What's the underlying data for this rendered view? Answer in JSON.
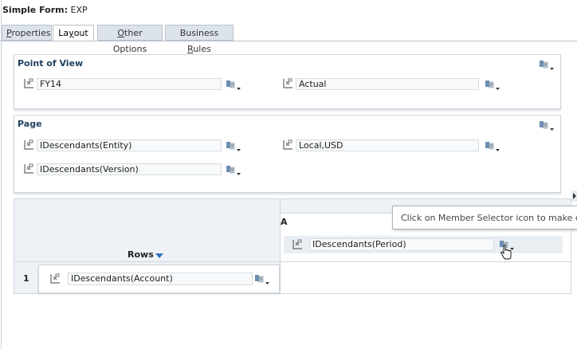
{
  "header": {
    "label": "Simple Form:",
    "value": "EXP"
  },
  "tabs": [
    {
      "label": "Properties",
      "accesskey": "P"
    },
    {
      "label": "Layout",
      "accesskey": "y"
    },
    {
      "label": "Other Options",
      "accesskey": "O"
    },
    {
      "label": "Business Rules",
      "accesskey": "R"
    }
  ],
  "active_tab": "Layout",
  "pov": {
    "title": "Point of View",
    "members": [
      "FY14",
      "Actual"
    ]
  },
  "page": {
    "title": "Page",
    "members": [
      "IDescendants(Entity)",
      "Local,USD",
      "IDescendants(Version)"
    ]
  },
  "layout_grid": {
    "rows_label": "Rows",
    "row_number": "1",
    "row_member": "IDescendants(Account)",
    "column_letter": "A",
    "column_member": "IDescendants(Period)"
  },
  "tooltip": "Click on Member Selector icon to make ch",
  "colors": {
    "panel_title": "#1f3f5e",
    "tab_bg": "#dde3ea",
    "header_bg": "#eef2f6"
  },
  "icons": [
    "member-icon",
    "member-selector-icon",
    "dropdown-arrow-icon",
    "expand-arrow-icon",
    "hand-cursor-icon"
  ]
}
